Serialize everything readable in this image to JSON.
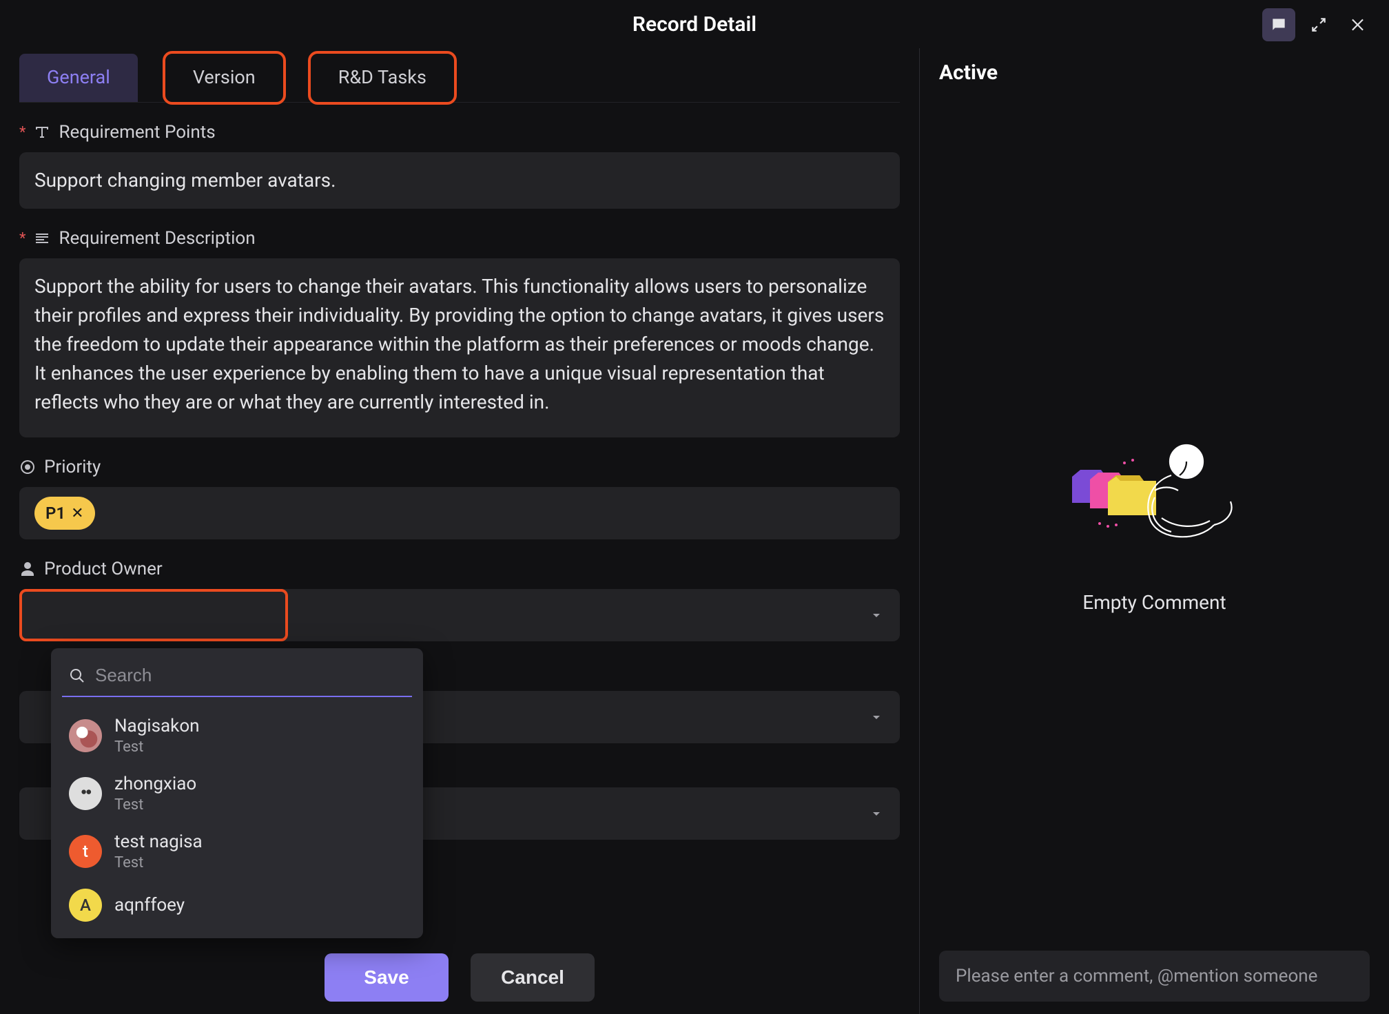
{
  "header": {
    "title": "Record Detail"
  },
  "tabs": [
    {
      "label": "General",
      "active": true
    },
    {
      "label": "Version",
      "active": false
    },
    {
      "label": "R&D Tasks",
      "active": false
    }
  ],
  "fields": {
    "req_points": {
      "label": "Requirement Points",
      "value": "Support changing member avatars."
    },
    "req_desc": {
      "label": "Requirement Description",
      "value": "Support the ability for users to change their avatars. This functionality allows users to personalize their profiles and express their individuality. By providing the option to change avatars, it gives users the freedom to update their appearance within the platform as their preferences or moods change. It enhances the user experience by enabling them to have a unique visual representation that reflects who they are or what they are currently interested in."
    },
    "priority": {
      "label": "Priority",
      "chip": "P1"
    },
    "product_owner": {
      "label": "Product Owner"
    }
  },
  "owner_search": {
    "placeholder": "Search",
    "options": [
      {
        "name": "Nagisakon",
        "sub": "Test",
        "color": "#c78b8b",
        "initial": ""
      },
      {
        "name": "zhongxiao",
        "sub": "Test",
        "color": "#dedede",
        "initial": ""
      },
      {
        "name": "test nagisa",
        "sub": "Test",
        "color": "#ee5b2f",
        "initial": "t"
      },
      {
        "name": "aqnffoey",
        "sub": "",
        "color": "#f2d94b",
        "initial": "A"
      }
    ]
  },
  "footer": {
    "save": "Save",
    "cancel": "Cancel"
  },
  "sidebar": {
    "title": "Active",
    "empty_text": "Empty Comment",
    "comment_placeholder": "Please enter a comment, @mention someone"
  }
}
